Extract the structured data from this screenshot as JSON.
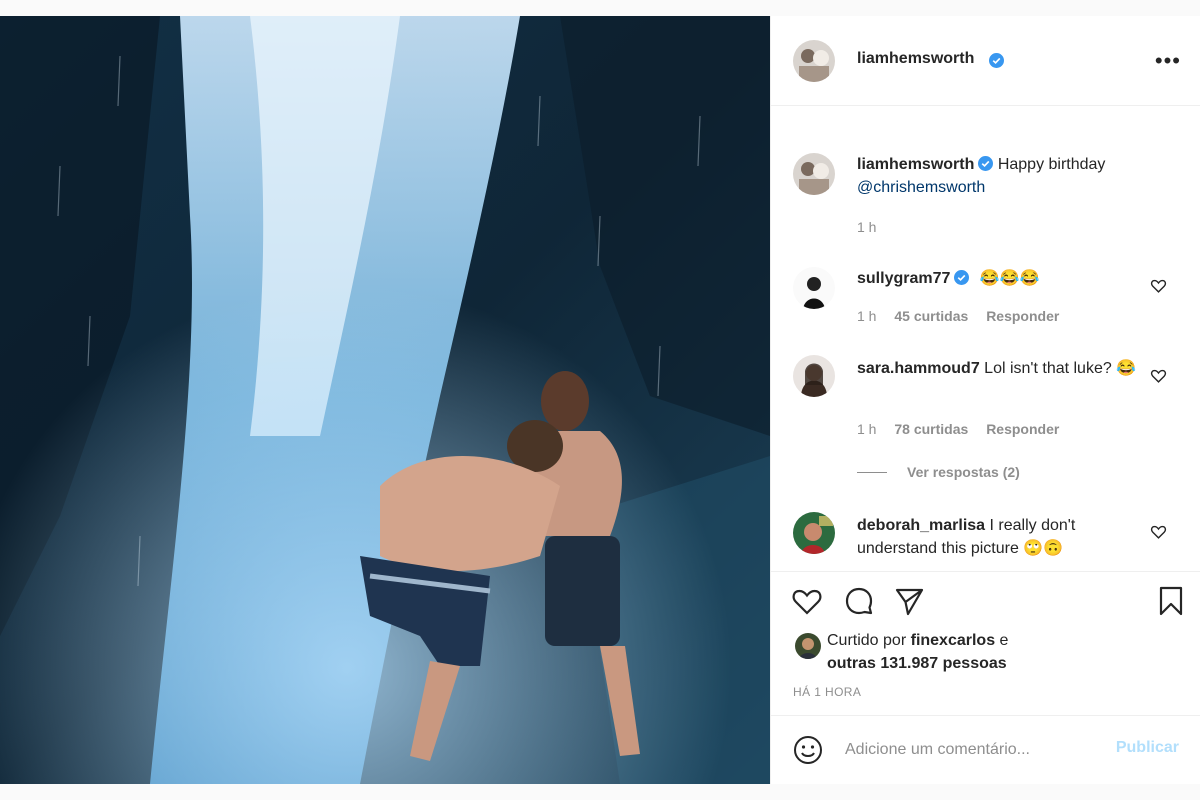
{
  "post": {
    "author": "liamhemsworth",
    "more_icon": "more-horizontal-icon",
    "caption": {
      "username": "liamhemsworth",
      "text": "Happy birthday",
      "mention": "@chrishemsworth",
      "time": "1 h"
    }
  },
  "comments": [
    {
      "username": "sullygram77",
      "verified": true,
      "text": "",
      "emojis": [
        "😂",
        "😂",
        "😂"
      ],
      "time": "1 h",
      "likes": "45 curtidas",
      "reply": "Responder"
    },
    {
      "username": "sara.hammoud7",
      "verified": false,
      "text": "Lol isn't that luke?",
      "emojis": [
        "😂"
      ],
      "time": "1 h",
      "likes": "78 curtidas",
      "reply": "Responder",
      "view_replies": "Ver respostas (2)"
    },
    {
      "username": "deborah_marlisa",
      "verified": false,
      "text": "I really don't understand this picture",
      "emojis": [
        "🙄",
        "🙃"
      ]
    }
  ],
  "actions": {
    "liked_by_prefix": "Curtido por",
    "liked_by_user": "finexcarlos",
    "liked_by_suffix": "e",
    "others": "outras 131.987 pessoas",
    "timestamp": "HÁ 1 HORA"
  },
  "add_comment": {
    "placeholder": "Adicione um comentário...",
    "publish": "Publicar"
  },
  "colors": {
    "verified": "#3897f0",
    "mention": "#00376b",
    "muted": "#8e8e8e",
    "publish_disabled": "#b2dffc"
  }
}
